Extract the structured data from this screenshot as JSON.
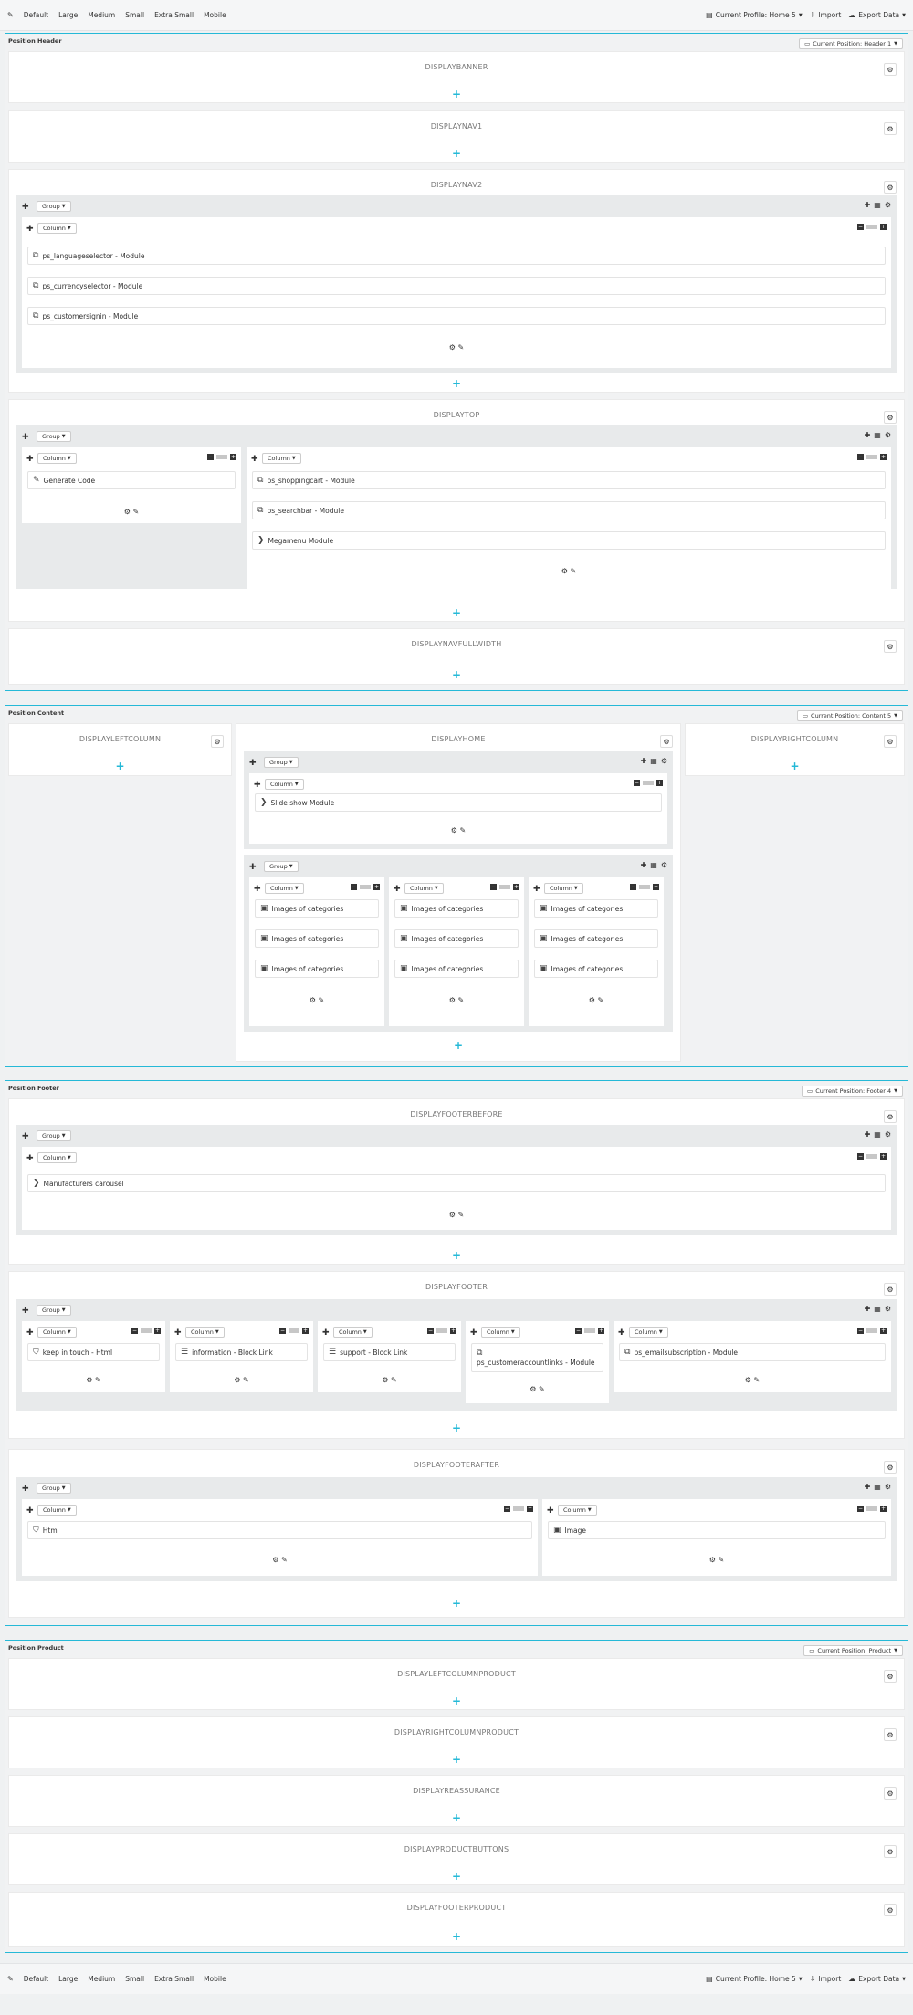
{
  "toolbar": {
    "edit_icon": "pencil-icon",
    "devices": [
      "Default",
      "Large",
      "Medium",
      "Small",
      "Extra Small",
      "Mobile"
    ],
    "profile": "Current Profile: Home 5",
    "import": "Import",
    "export": "Export Data"
  },
  "labels": {
    "group": "Group",
    "column": "Column"
  },
  "header": {
    "title": "Position Header",
    "current": "Current Position: Header 1",
    "hooks": {
      "banner": "DISPLAYBANNER",
      "nav1": "DISPLAYNAV1",
      "nav2": "DISPLAYNAV2",
      "top": "DISPLAYTOP",
      "navfull": "DISPLAYNAVFULLWIDTH"
    },
    "nav2_modules": [
      "ps_languageselector - Module",
      "ps_currencyselector - Module",
      "ps_customersignin - Module"
    ],
    "top_col1_modules": [
      "Generate Code"
    ],
    "top_col2_modules": [
      "ps_shoppingcart - Module",
      "ps_searchbar - Module",
      "Megamenu Module"
    ]
  },
  "content": {
    "title": "Position Content",
    "current": "Current Position: Content 5",
    "hooks": {
      "left": "DISPLAYLEFTCOLUMN",
      "home": "DISPLAYHOME",
      "right": "DISPLAYRIGHTCOLUMN"
    },
    "slideshow": "Slide show Module",
    "images": "Images of categories"
  },
  "footer": {
    "title": "Position Footer",
    "current": "Current Position: Footer 4",
    "hooks": {
      "before": "DISPLAYFOOTERBEFORE",
      "footer": "DISPLAYFOOTER",
      "after": "DISPLAYFOOTERAFTER"
    },
    "manufacturers": "Manufacturers carousel",
    "footer_modules": [
      "keep in touch - Html",
      "information - Block Link",
      "support - Block Link",
      "ps_customeraccountlinks - Module",
      "ps_emailsubscription - Module"
    ],
    "after_modules": [
      "Html",
      "Image"
    ]
  },
  "product": {
    "title": "Position Product",
    "current": "Current Position: Product",
    "hooks": [
      "DISPLAYLEFTCOLUMNPRODUCT",
      "DISPLAYRIGHTCOLUMNPRODUCT",
      "DISPLAYREASSURANCE",
      "DISPLAYPRODUCTBUTTONS",
      "DISPLAYFOOTERPRODUCT"
    ]
  },
  "colors": {
    "accent": "#25b9d7",
    "background": "#eff1f2"
  }
}
